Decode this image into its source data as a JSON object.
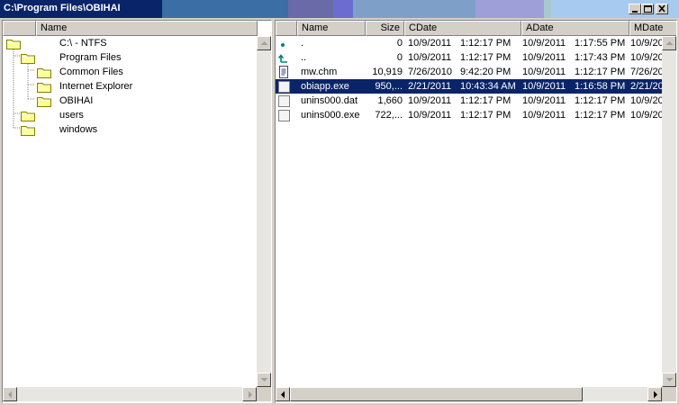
{
  "window": {
    "title": "C:\\Program Files\\OBIHAI",
    "title_colors": [
      "#0a246a",
      "#3a6ea5",
      "#a6caf0"
    ]
  },
  "tree": {
    "header": "Name",
    "items": [
      {
        "label": "C:\\ - NTFS",
        "icon": "folder-icon"
      },
      {
        "label": "Program Files",
        "icon": "folder-icon"
      },
      {
        "label": "Common Files",
        "icon": "folder-icon"
      },
      {
        "label": "Internet Explorer",
        "icon": "folder-icon"
      },
      {
        "label": "OBIHAI",
        "icon": "folder-icon"
      },
      {
        "label": "users",
        "icon": "folder-icon"
      },
      {
        "label": "windows",
        "icon": "folder-icon"
      }
    ]
  },
  "files": {
    "columns": [
      "Name",
      "Size",
      "CDate",
      "ADate",
      "MDate"
    ],
    "rows": [
      {
        "name": ".",
        "size": "0",
        "cdate": "10/9/2011",
        "ctime": "1:12:17 PM",
        "adate": "10/9/2011",
        "atime": "1:17:55 PM",
        "mdate": "10/9/20",
        "icon": "current-dir-icon"
      },
      {
        "name": "..",
        "size": "0",
        "cdate": "10/9/2011",
        "ctime": "1:12:17 PM",
        "adate": "10/9/2011",
        "atime": "1:17:43 PM",
        "mdate": "10/9/20",
        "icon": "parent-dir-icon"
      },
      {
        "name": "mw.chm",
        "size": "10,919",
        "cdate": "7/26/2010",
        "ctime": "9:42:20 PM",
        "adate": "10/9/2011",
        "atime": "1:12:17 PM",
        "mdate": "7/26/20",
        "icon": "help-file-icon"
      },
      {
        "name": "obiapp.exe",
        "size": "950,...",
        "cdate": "2/21/2011",
        "ctime": "10:43:34 AM",
        "adate": "10/9/2011",
        "atime": "1:16:58 PM",
        "mdate": "2/21/20",
        "icon": "file-icon",
        "selected": true
      },
      {
        "name": "unins000.dat",
        "size": "1,660",
        "cdate": "10/9/2011",
        "ctime": "1:12:17 PM",
        "adate": "10/9/2011",
        "atime": "1:12:17 PM",
        "mdate": "10/9/20",
        "icon": "file-icon"
      },
      {
        "name": "unins000.exe",
        "size": "722,...",
        "cdate": "10/9/2011",
        "ctime": "1:12:17 PM",
        "adate": "10/9/2011",
        "atime": "1:12:17 PM",
        "mdate": "10/9/20",
        "icon": "file-icon"
      }
    ]
  }
}
